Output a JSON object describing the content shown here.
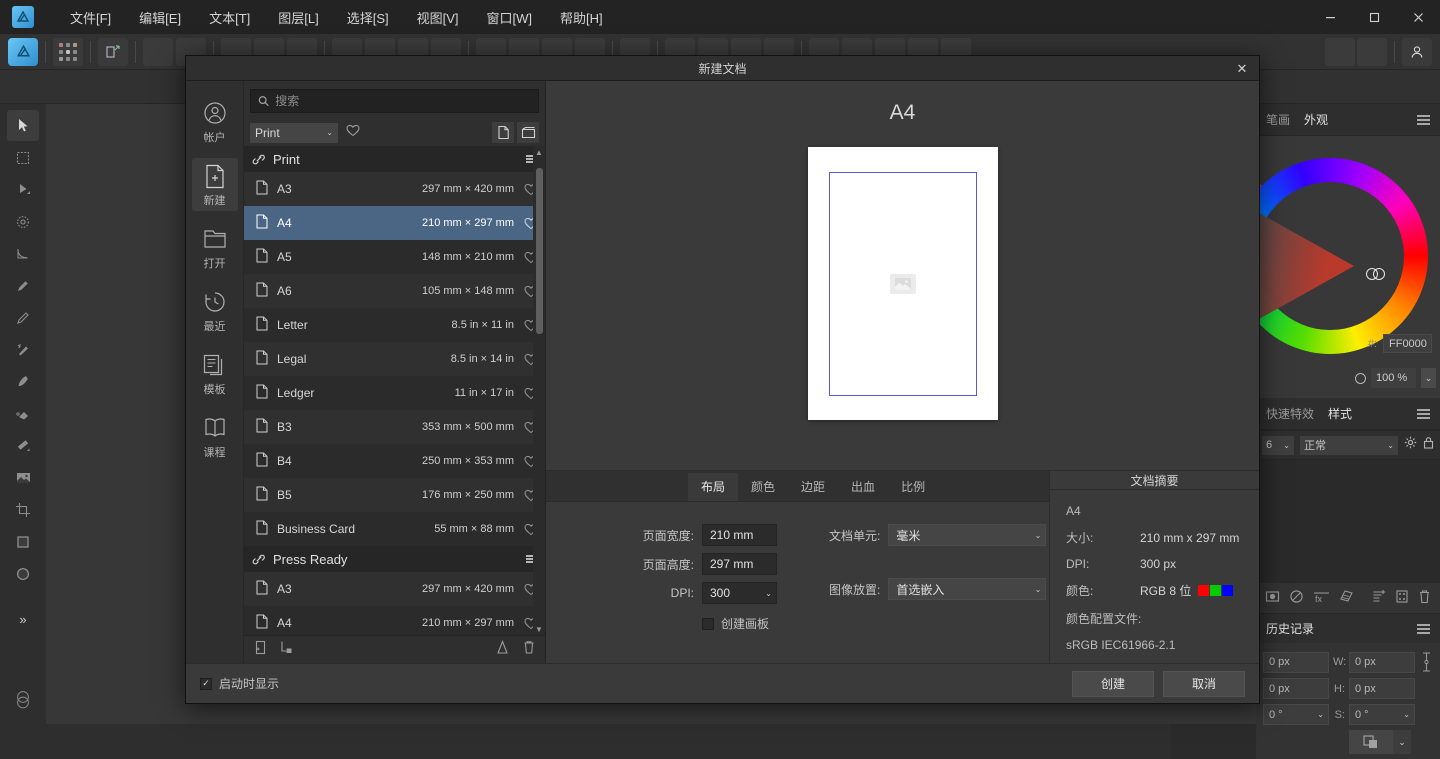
{
  "window": {
    "menus": [
      "文件[F]",
      "编辑[E]",
      "文本[T]",
      "图层[L]",
      "选择[S]",
      "视图[V]",
      "窗口[W]",
      "帮助[H]"
    ],
    "controls": {
      "minimize": "—",
      "maximize": "▢",
      "close": "✕"
    }
  },
  "dialog": {
    "title": "新建文档",
    "close": "✕",
    "sidebar": [
      {
        "label": "帐户",
        "icon": "account-icon"
      },
      {
        "label": "新建",
        "icon": "new-document-icon"
      },
      {
        "label": "打开",
        "icon": "open-folder-icon"
      },
      {
        "label": "最近",
        "icon": "recent-clock-icon"
      },
      {
        "label": "模板",
        "icon": "templates-icon"
      },
      {
        "label": "课程",
        "icon": "courses-book-icon"
      }
    ],
    "search": {
      "placeholder": "搜索",
      "value": ""
    },
    "category": {
      "selected": "Print",
      "chevron": "⌄"
    },
    "groups": [
      {
        "title": "Print",
        "presets": [
          {
            "name": "A3",
            "dim": "297 mm × 420 mm"
          },
          {
            "name": "A4",
            "dim": "210 mm × 297 mm",
            "selected": true
          },
          {
            "name": "A5",
            "dim": "148 mm × 210 mm"
          },
          {
            "name": "A6",
            "dim": "105 mm × 148 mm"
          },
          {
            "name": "Letter",
            "dim": "8.5 in × 11 in"
          },
          {
            "name": "Legal",
            "dim": "8.5 in × 14 in"
          },
          {
            "name": "Ledger",
            "dim": "11 in × 17 in"
          },
          {
            "name": "B3",
            "dim": "353 mm × 500 mm"
          },
          {
            "name": "B4",
            "dim": "250 mm × 353 mm"
          },
          {
            "name": "B5",
            "dim": "176 mm × 250 mm"
          },
          {
            "name": "Business Card",
            "dim": "55 mm × 88 mm"
          }
        ]
      },
      {
        "title": "Press Ready",
        "presets": [
          {
            "name": "A3",
            "dim": "297 mm × 420 mm"
          },
          {
            "name": "A4",
            "dim": "210 mm × 297 mm"
          }
        ]
      }
    ],
    "preview": {
      "title": "A4",
      "placeholder_icon": "image-placeholder-icon"
    },
    "tabs": [
      {
        "label": "布局",
        "active": true
      },
      {
        "label": "颜色",
        "active": false
      },
      {
        "label": "边距",
        "active": false
      },
      {
        "label": "出血",
        "active": false
      },
      {
        "label": "比例",
        "active": false
      }
    ],
    "form": {
      "page_width_label": "页面宽度:",
      "page_width_value": "210 mm",
      "page_height_label": "页面高度:",
      "page_height_value": "297 mm",
      "dpi_label": "DPI:",
      "dpi_value": "300",
      "create_artboard_label": "创建画板",
      "doc_unit_label": "文档单元:",
      "doc_unit_value": "毫米",
      "image_placement_label": "图像放置:",
      "image_placement_value": "首选嵌入"
    },
    "summary": {
      "heading": "文档摘要",
      "preset": "A4",
      "size_label": "大小:",
      "size_value": "210 mm  x  297 mm",
      "dpi_label": "DPI:",
      "dpi_value": "300 px",
      "color_label": "颜色:",
      "color_value": "RGB 8 位",
      "swatches": [
        "#ff0000",
        "#00cc00",
        "#0000ff"
      ],
      "profile_label": "颜色配置文件:",
      "profile_value": "sRGB IEC61966-2.1"
    },
    "footer": {
      "show_on_startup": "启动时显示",
      "checked": true,
      "create": "创建",
      "cancel": "取消"
    }
  },
  "right_panel": {
    "tabs_top": [
      {
        "label": "笔画",
        "active": false
      },
      {
        "label": "外观",
        "active": true
      }
    ],
    "color": {
      "hex_label": "#:",
      "hex_value": "FF0000",
      "opacity_value": "100 %",
      "accent": "#FF0000"
    },
    "tabs_fx": [
      {
        "label": "快速特效",
        "active": false
      },
      {
        "label": "样式",
        "active": true
      }
    ],
    "layers": {
      "opacity": "6",
      "blend_mode": "正常"
    },
    "history": {
      "title": "历史记录"
    },
    "transform": {
      "x_value": "0 px",
      "y_value": "0 px",
      "w_label": "W:",
      "w_value": "0 px",
      "h_label": "H:",
      "h_value": "0 px",
      "r_value": "0 °",
      "s_label": "S:",
      "s_value": "0 °"
    }
  }
}
